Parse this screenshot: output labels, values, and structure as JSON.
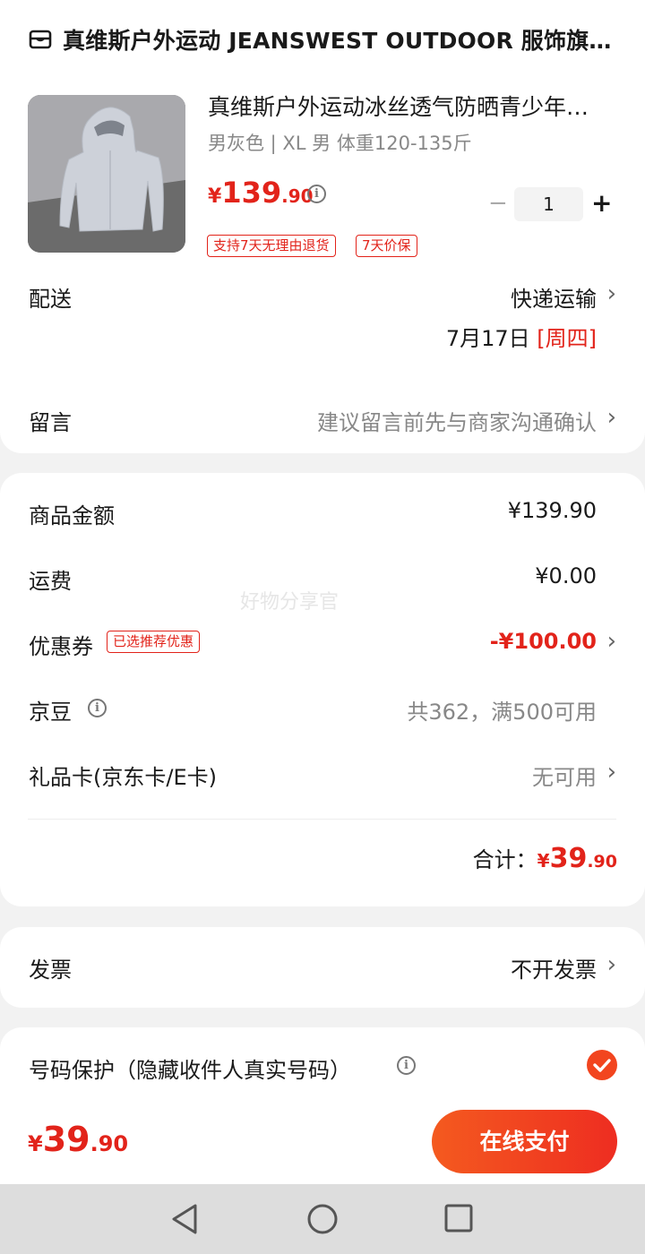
{
  "store": {
    "name": "真维斯户外运动 JEANSWEST OUTDOOR 服饰旗…",
    "icon": "store-icon"
  },
  "product": {
    "title": "真维斯户外运动冰丝透气防晒青少年…",
    "spec": "男灰色 | XL 男  体重120-135斤",
    "price_symbol": "¥",
    "price_int": "139",
    "price_dec": ".90",
    "quantity": "1",
    "tags": [
      "支持7天无理由退货",
      "7天价保"
    ]
  },
  "delivery": {
    "label": "配送",
    "method": "快递运输",
    "date": "7月17日",
    "weekday": "[周四]"
  },
  "message": {
    "label": "留言",
    "placeholder": "建议留言前先与商家沟通确认"
  },
  "summary": {
    "goods_label": "商品金额",
    "goods_value": "¥139.90",
    "shipping_label": "运费",
    "shipping_value": "¥0.00",
    "coupon_label": "优惠券",
    "coupon_tag": "已选推荐优惠",
    "coupon_value": "-¥100.00",
    "jingdou_label": "京豆",
    "jingdou_value": "共362，满500可用",
    "giftcard_label": "礼品卡(京东卡/E卡)",
    "giftcard_value": "无可用",
    "total_label": "合计：",
    "total_symbol": "¥",
    "total_int": "39",
    "total_dec": ".90"
  },
  "watermark": "好物分享官",
  "invoice": {
    "label": "发票",
    "value": "不开发票"
  },
  "privacy": {
    "label": "号码保护（隐藏收件人真实号码）",
    "checked": true
  },
  "footer": {
    "symbol": "¥",
    "int": "39",
    "dec": ".90",
    "pay_label": "在线支付"
  },
  "colors": {
    "accent": "#e2231a",
    "button": "#f2451f"
  }
}
